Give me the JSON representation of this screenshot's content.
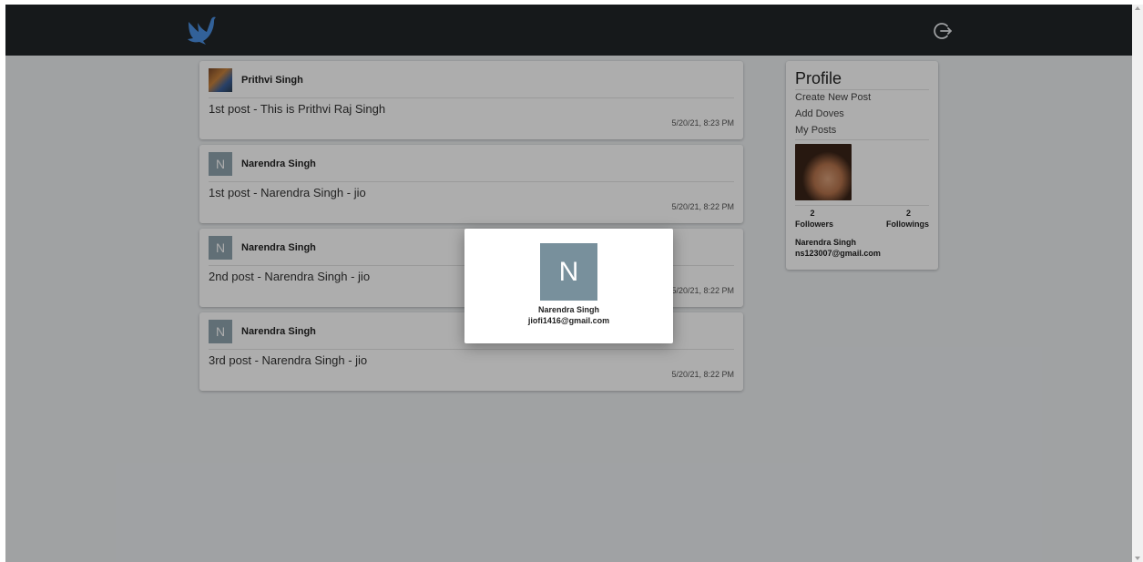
{
  "header": {
    "logo_icon": "dove-icon",
    "logout_icon": "logout-icon",
    "bg_color": "#212529",
    "logo_color": "#4a90e2"
  },
  "posts": [
    {
      "author": "Prithvi Singh",
      "avatar": "photo",
      "text": "1st post - This is Prithvi Raj Singh",
      "time": "5/20/21, 8:23 PM"
    },
    {
      "author": "Narendra Singh",
      "avatar": "N",
      "text": "1st post - Narendra Singh - jio",
      "time": "5/20/21, 8:22 PM"
    },
    {
      "author": "Narendra Singh",
      "avatar": "N",
      "text": "2nd post - Narendra Singh - jio",
      "time": "5/20/21, 8:22 PM"
    },
    {
      "author": "Narendra Singh",
      "avatar": "N",
      "text": "3rd post - Narendra Singh - jio",
      "time": "5/20/21, 8:22 PM"
    }
  ],
  "profile": {
    "title": "Profile",
    "links": [
      "Create New Post",
      "Add Doves",
      "My Posts"
    ],
    "followers_count": "2",
    "followers_label": "Followers",
    "followings_count": "2",
    "followings_label": "Followings",
    "name": "Narendra Singh",
    "email": "ns123007@gmail.com"
  },
  "modal": {
    "avatar_letter": "N",
    "name": "Narendra Singh",
    "email": "jiofi1416@gmail.com"
  }
}
